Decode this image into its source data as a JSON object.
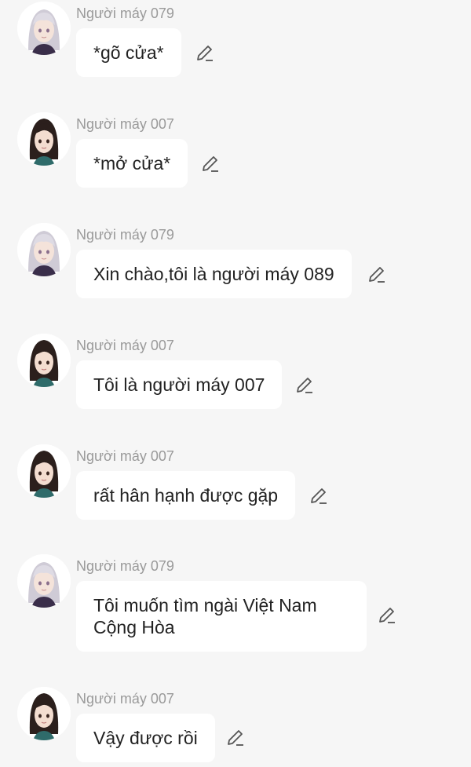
{
  "messages": [
    {
      "sender": "Người máy 079",
      "avatar": "silver-hair-girl-avatar",
      "text": "*gõ cửa*"
    },
    {
      "sender": "Người máy 007",
      "avatar": "dark-hair-girl-avatar",
      "text": "*mở cửa*"
    },
    {
      "sender": "Người máy 079",
      "avatar": "silver-hair-girl-avatar",
      "text": "Xin chào,tôi là người máy 089"
    },
    {
      "sender": "Người máy 007",
      "avatar": "dark-hair-girl-avatar",
      "text": "Tôi là người máy 007"
    },
    {
      "sender": "Người máy 007",
      "avatar": "dark-hair-girl-avatar",
      "text": "rất hân hạnh được gặp"
    },
    {
      "sender": "Người máy 079",
      "avatar": "silver-hair-girl-avatar",
      "text": "Tôi muốn tìm ngài Việt Nam Cộng Hòa"
    },
    {
      "sender": "Người máy 007",
      "avatar": "dark-hair-girl-avatar",
      "text": "Vậy được rồi"
    }
  ],
  "icons": {
    "edit": "pencil-icon"
  },
  "colors": {
    "background": "#f6f6f6",
    "bubble": "#ffffff",
    "sender_text": "#9a9a9a",
    "message_text": "#222222"
  }
}
